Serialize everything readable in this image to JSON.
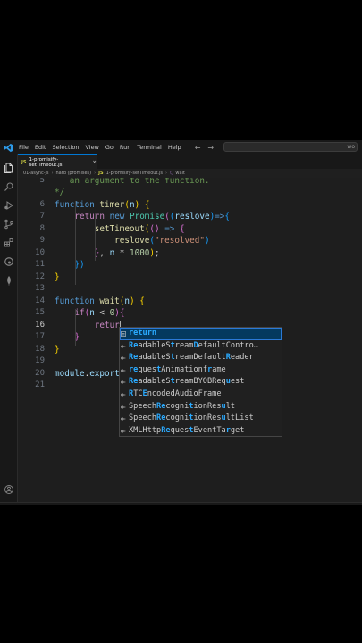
{
  "menu": [
    "File",
    "Edit",
    "Selection",
    "View",
    "Go",
    "Run",
    "Terminal",
    "Help"
  ],
  "search": {
    "text": "wo"
  },
  "tab": {
    "badge": "JS",
    "label": "1-promisify-setTimeout.js",
    "close": "×"
  },
  "breadcrumb": {
    "parts": [
      "01-async-js",
      "hard (promises)",
      "1-promisify-setTimeout.js",
      "wait"
    ],
    "badge": "JS",
    "fn_icon": "⬡"
  },
  "editor": {
    "lines": [
      {
        "n": "5",
        "html": "<span class=\"cmt\">   an argument to the function.</span>"
      },
      {
        "n": "",
        "html": "<span class=\"cmt\">*/</span>"
      },
      {
        "n": "6",
        "html": "<span class=\"kw\">function</span> <span class=\"fn\">timer</span><span class=\"b1\">(</span><span class=\"var\">n</span><span class=\"b1\">)</span> <span class=\"b1\">{</span>"
      },
      {
        "n": "7",
        "html": "    <span class=\"ctl\">return</span> <span class=\"kw\">new</span> <span class=\"cls\">Promise</span><span class=\"b2\">(</span><span class=\"b3\">(</span><span class=\"var\">reslove</span><span class=\"b3\">)</span><span class=\"kw\">=&gt;</span><span class=\"b3\">{</span>"
      },
      {
        "n": "8",
        "html": "        <span class=\"fn\">setTimeout</span><span class=\"b1\">(</span><span class=\"b2\">()</span> <span class=\"kw\">=&gt;</span> <span class=\"b2\">{</span>"
      },
      {
        "n": "9",
        "html": "            <span class=\"fn\">reslove</span><span class=\"b3\">(</span><span class=\"str\">\"resolved\"</span><span class=\"b3\">)</span>"
      },
      {
        "n": "10",
        "html": "        <span class=\"b2\">}</span>, <span class=\"var\">n</span> * <span class=\"num\">1000</span><span class=\"b1\">)</span>;"
      },
      {
        "n": "11",
        "html": "    <span class=\"b3\">})</span>"
      },
      {
        "n": "12",
        "html": "<span class=\"b1\">}</span>"
      },
      {
        "n": "13",
        "html": ""
      },
      {
        "n": "14",
        "html": "<span class=\"kw\">function</span> <span class=\"fn\">wait</span><span class=\"b1\">(</span><span class=\"var\">n</span><span class=\"b1\">)</span> <span class=\"b1\">{</span>"
      },
      {
        "n": "15",
        "html": "    <span class=\"ctl\">if</span><span class=\"b2\">(</span><span class=\"var\">n</span> &lt; <span class=\"num\">0</span><span class=\"b2\">)</span><span class=\"b2\">{</span>"
      },
      {
        "n": "16",
        "html": "        <span class=\"ctl\">retur</span><span class=\"cursor\"></span>"
      },
      {
        "n": "17",
        "html": "    <span class=\"b2\">}</span>"
      },
      {
        "n": "18",
        "html": "<span class=\"b1\">}</span>"
      },
      {
        "n": "19",
        "html": ""
      },
      {
        "n": "20",
        "html": "<span class=\"var\">module</span>.<span class=\"var\">export</span>"
      },
      {
        "n": "21",
        "html": ""
      }
    ]
  },
  "suggestions": [
    {
      "icon": "keyword",
      "html": "<span class=\"hl\">return</span>"
    },
    {
      "icon": "interface",
      "html": "<span class=\"hl\">R</span><span class=\"hl\">e</span>adableS<span class=\"hl\">t</span>ream<span class=\"hl\">D</span>efaultContro…"
    },
    {
      "icon": "interface",
      "html": "<span class=\"hl\">Re</span>adableS<span class=\"hl\">t</span>reamDefault<span class=\"hl\">R</span>eader"
    },
    {
      "icon": "interface",
      "html": "<span class=\"hl\">re</span>ques<span class=\"hl\">t</span>Animationf<span class=\"hl\">r</span>ame"
    },
    {
      "icon": "interface",
      "html": "<span class=\"hl\">Re</span>adableS<span class=\"hl\">t</span>reamBYOBReq<span class=\"hl\">u</span>est"
    },
    {
      "icon": "interface",
      "html": "<span class=\"hl\">R</span>TC<span class=\"hl\">E</span>ncodedAudioFrame"
    },
    {
      "icon": "interface",
      "html": "Speech<span class=\"hl\">Re</span>cogni<span class=\"hl\">t</span>ionRes<span class=\"hl\">u</span>lt"
    },
    {
      "icon": "interface",
      "html": "Speech<span class=\"hl\">Re</span>cogni<span class=\"hl\">t</span>ionRes<span class=\"hl\">u</span>ltList"
    },
    {
      "icon": "interface",
      "html": "XMLHttp<span class=\"hl\">Re</span>ques<span class=\"hl\">t</span>EventTa<span class=\"hl\">r</span>get"
    }
  ],
  "colors": {
    "accent": "#0078d4",
    "editor_bg": "#1e1e1e",
    "match": "#2aaaff"
  }
}
